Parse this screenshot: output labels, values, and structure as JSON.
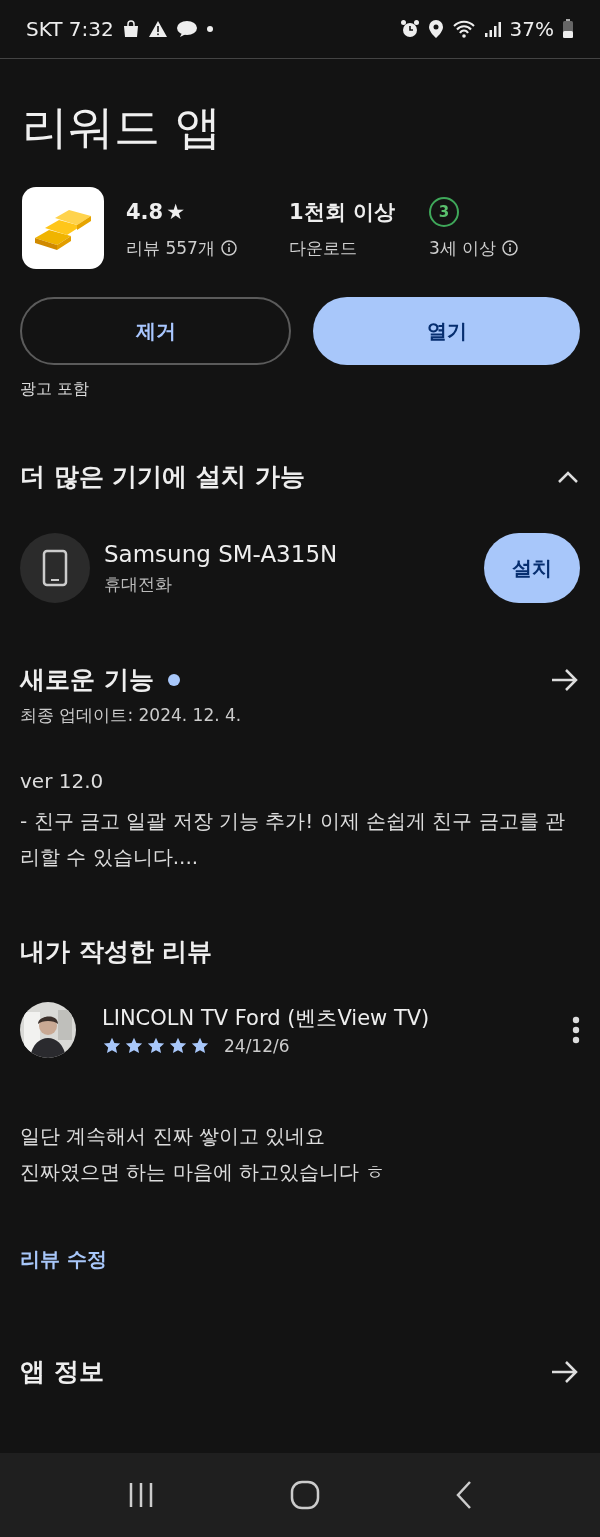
{
  "status_bar": {
    "carrier_time": "SKT 7:32",
    "battery": "37%"
  },
  "app": {
    "title": "리워드 앱",
    "rating": "4.8",
    "rating_star": "★",
    "reviews": "리뷰 557개",
    "downloads": "1천회 이상",
    "downloads_label": "다운로드",
    "age_badge": "3",
    "age_label": "3세 이상"
  },
  "buttons": [
    {
      "label": "제거",
      "kind": "outline"
    },
    {
      "label": "열기",
      "kind": "filled"
    }
  ],
  "ads_note": "광고 포함",
  "more_devices": {
    "title": "더 많은 기기에 설치 가능",
    "expanded": true,
    "device": {
      "name": "Samsung SM-A315N",
      "type": "휴대전화",
      "button": "설치"
    }
  },
  "whats_new": {
    "title": "새로운 기능",
    "updated": "최종 업데이트: 2024. 12. 4.",
    "version": "ver 12.0",
    "body": "- 친구 금고 일괄 저장 기능 추가! 이제 손쉽게 친구 금고를 관리할 수 있습니다...."
  },
  "my_review": {
    "title": "내가 작성한 리뷰",
    "author": "LINCOLN TV Ford (벤츠View TV)",
    "stars": 5,
    "date": "24/12/6",
    "lines": [
      "일단 계속해서 진짜 쌓이고 있네요",
      "진짜였으면 하는 마음에 하고있습니다 ㅎ"
    ],
    "edit_link": "리뷰 수정"
  },
  "app_info": {
    "title": "앱 정보"
  }
}
